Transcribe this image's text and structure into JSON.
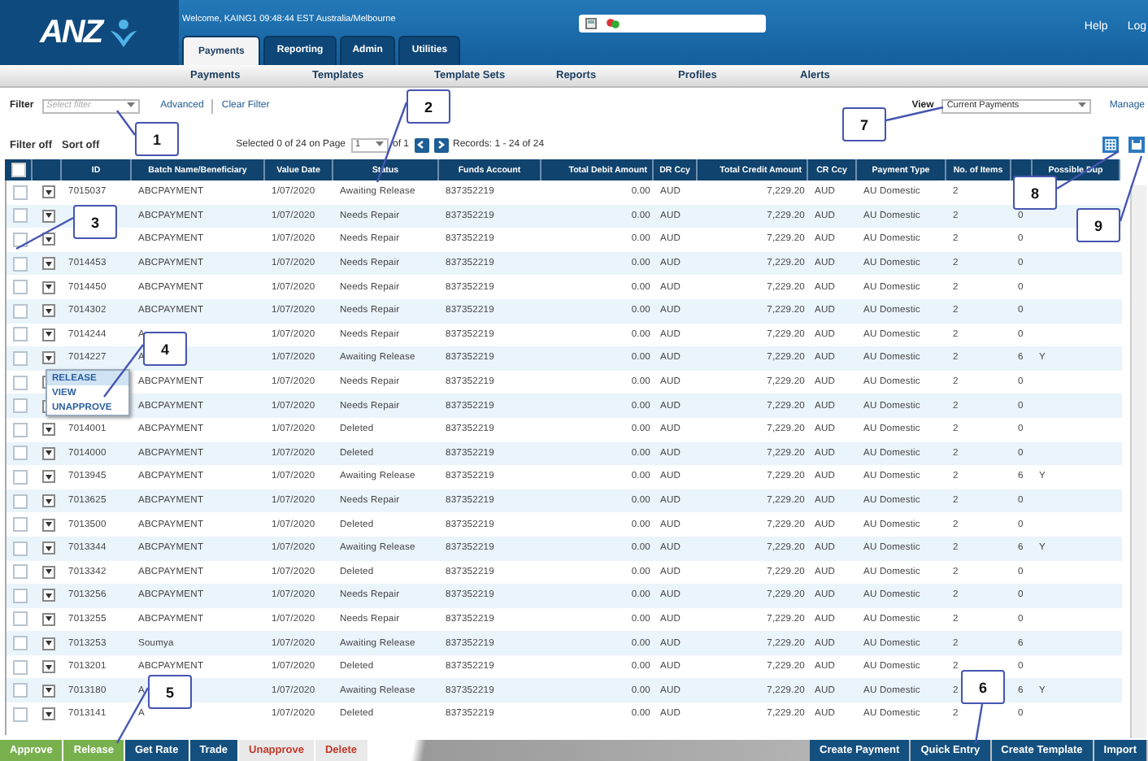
{
  "header": {
    "logo": "ANZ",
    "welcome": "Welcome, KAING1 09:48:44 EST Australia/Melbourne",
    "links": [
      "Help",
      "Log"
    ]
  },
  "tabs": [
    {
      "label": "Payments",
      "selected": true
    },
    {
      "label": "Reporting",
      "selected": false
    },
    {
      "label": "Admin",
      "selected": false
    },
    {
      "label": "Utilities",
      "selected": false
    }
  ],
  "subnav": [
    "Payments",
    "Templates",
    "Template Sets",
    "Reports",
    "Profiles",
    "Alerts"
  ],
  "filter": {
    "label": "Filter",
    "placeholder": "Select filter",
    "links": [
      "Advanced",
      "Clear Filter"
    ],
    "view_label": "View",
    "view_value": "Current Payments",
    "manage": "Manage"
  },
  "toolbar": {
    "filter_state": "Filter off",
    "sort_state": "Sort off",
    "selected_text": "Selected 0 of 24 on Page",
    "page": "1",
    "page_of": "of 1",
    "records": "Records: 1 - 24 of 24"
  },
  "table": {
    "all_checked": false,
    "columns": [
      "ID",
      "Batch Name/Beneficiary",
      "Value Date",
      "Status",
      "Funds Account",
      "Total Debit Amount",
      "DR Ccy",
      "Total Credit Amount",
      "CR Ccy",
      "Payment Type",
      "No. of Items",
      "",
      "Possible Dup"
    ],
    "rows": [
      {
        "checked": false,
        "cells": [
          "7015037",
          "ABCPAYMENT",
          "1/07/2020",
          "Awaiting Release",
          "837352219",
          "0.00",
          "AUD",
          "7,229.20",
          "AUD",
          "AU Domestic",
          "2",
          null,
          null
        ]
      },
      {
        "checked": false,
        "cells": [
          null,
          "ABCPAYMENT",
          "1/07/2020",
          "Needs Repair",
          "837352219",
          "0.00",
          "AUD",
          "7,229.20",
          "AUD",
          "AU Domestic",
          "2",
          "0",
          null
        ]
      },
      {
        "checked": false,
        "cells": [
          null,
          "ABCPAYMENT",
          "1/07/2020",
          "Needs Repair",
          "837352219",
          "0.00",
          "AUD",
          "7,229.20",
          "AUD",
          "AU Domestic",
          "2",
          "0",
          null
        ]
      },
      {
        "checked": false,
        "cells": [
          "7014453",
          "ABCPAYMENT",
          "1/07/2020",
          "Needs Repair",
          "837352219",
          "0.00",
          "AUD",
          "7,229.20",
          "AUD",
          "AU Domestic",
          "2",
          "0",
          null
        ]
      },
      {
        "checked": false,
        "cells": [
          "7014450",
          "ABCPAYMENT",
          "1/07/2020",
          "Needs Repair",
          "837352219",
          "0.00",
          "AUD",
          "7,229.20",
          "AUD",
          "AU Domestic",
          "2",
          "0",
          null
        ]
      },
      {
        "checked": false,
        "cells": [
          "7014302",
          "ABCPAYMENT",
          "1/07/2020",
          "Needs Repair",
          "837352219",
          "0.00",
          "AUD",
          "7,229.20",
          "AUD",
          "AU Domestic",
          "2",
          "0",
          null
        ]
      },
      {
        "checked": false,
        "cells": [
          "7014244",
          "A",
          "1/07/2020",
          "Needs Repair",
          "837352219",
          "0.00",
          "AUD",
          "7,229.20",
          "AUD",
          "AU Domestic",
          "2",
          "0",
          null
        ]
      },
      {
        "checked": false,
        "cells": [
          "7014227",
          "A",
          "1/07/2020",
          "Awaiting Release",
          "837352219",
          "0.00",
          "AUD",
          "7,229.20",
          "AUD",
          "AU Domestic",
          "2",
          "6",
          "Y"
        ]
      },
      {
        "checked": false,
        "cells": [
          null,
          "ABCPAYMENT",
          "1/07/2020",
          "Needs Repair",
          "837352219",
          "0.00",
          "AUD",
          "7,229.20",
          "AUD",
          "AU Domestic",
          "2",
          "0",
          null
        ]
      },
      {
        "checked": false,
        "cells": [
          null,
          "ABCPAYMENT",
          "1/07/2020",
          "Needs Repair",
          "837352219",
          "0.00",
          "AUD",
          "7,229.20",
          "AUD",
          "AU Domestic",
          "2",
          "0",
          null
        ]
      },
      {
        "checked": false,
        "cells": [
          "7014001",
          "ABCPAYMENT",
          "1/07/2020",
          "Deleted",
          "837352219",
          "0.00",
          "AUD",
          "7,229.20",
          "AUD",
          "AU Domestic",
          "2",
          "0",
          null
        ]
      },
      {
        "checked": false,
        "cells": [
          "7014000",
          "ABCPAYMENT",
          "1/07/2020",
          "Deleted",
          "837352219",
          "0.00",
          "AUD",
          "7,229.20",
          "AUD",
          "AU Domestic",
          "2",
          "0",
          null
        ]
      },
      {
        "checked": false,
        "cells": [
          "7013945",
          "ABCPAYMENT",
          "1/07/2020",
          "Awaiting Release",
          "837352219",
          "0.00",
          "AUD",
          "7,229.20",
          "AUD",
          "AU Domestic",
          "2",
          "6",
          "Y"
        ]
      },
      {
        "checked": false,
        "cells": [
          "7013625",
          "ABCPAYMENT",
          "1/07/2020",
          "Needs Repair",
          "837352219",
          "0.00",
          "AUD",
          "7,229.20",
          "AUD",
          "AU Domestic",
          "2",
          "0",
          null
        ]
      },
      {
        "checked": false,
        "cells": [
          "7013500",
          "ABCPAYMENT",
          "1/07/2020",
          "Deleted",
          "837352219",
          "0.00",
          "AUD",
          "7,229.20",
          "AUD",
          "AU Domestic",
          "2",
          "0",
          null
        ]
      },
      {
        "checked": false,
        "cells": [
          "7013344",
          "ABCPAYMENT",
          "1/07/2020",
          "Awaiting Release",
          "837352219",
          "0.00",
          "AUD",
          "7,229.20",
          "AUD",
          "AU Domestic",
          "2",
          "6",
          "Y"
        ]
      },
      {
        "checked": false,
        "cells": [
          "7013342",
          "ABCPAYMENT",
          "1/07/2020",
          "Deleted",
          "837352219",
          "0.00",
          "AUD",
          "7,229.20",
          "AUD",
          "AU Domestic",
          "2",
          "0",
          null
        ]
      },
      {
        "checked": false,
        "cells": [
          "7013256",
          "ABCPAYMENT",
          "1/07/2020",
          "Needs Repair",
          "837352219",
          "0.00",
          "AUD",
          "7,229.20",
          "AUD",
          "AU Domestic",
          "2",
          "0",
          null
        ]
      },
      {
        "checked": false,
        "cells": [
          "7013255",
          "ABCPAYMENT",
          "1/07/2020",
          "Needs Repair",
          "837352219",
          "0.00",
          "AUD",
          "7,229.20",
          "AUD",
          "AU Domestic",
          "2",
          "0",
          null
        ]
      },
      {
        "checked": false,
        "cells": [
          "7013253",
          "Soumya",
          "1/07/2020",
          "Awaiting Release",
          "837352219",
          "0.00",
          "AUD",
          "7,229.20",
          "AUD",
          "AU Domestic",
          "2",
          "6",
          null
        ]
      },
      {
        "checked": false,
        "cells": [
          "7013201",
          "ABCPAYMENT",
          "1/07/2020",
          "Deleted",
          "837352219",
          "0.00",
          "AUD",
          "7,229.20",
          "AUD",
          "AU Domestic",
          "2",
          "0",
          null
        ]
      },
      {
        "checked": false,
        "cells": [
          "7013180",
          "A",
          "1/07/2020",
          "Awaiting Release",
          "837352219",
          "0.00",
          "AUD",
          "7,229.20",
          "AUD",
          "AU Domestic",
          "2",
          "6",
          "Y"
        ]
      },
      {
        "checked": false,
        "cells": [
          "7013141",
          "A",
          "1/07/2020",
          "Deleted",
          "837352219",
          "0.00",
          "AUD",
          "7,229.20",
          "AUD",
          "AU Domestic",
          "2",
          "0",
          null
        ]
      }
    ]
  },
  "row_menu": {
    "items": [
      {
        "label": "RELEASE",
        "selected": true
      },
      {
        "label": "VIEW",
        "selected": false
      },
      {
        "label": "UNAPPROVE",
        "selected": false
      }
    ]
  },
  "actions_left": [
    {
      "label": "Approve",
      "kind": "green"
    },
    {
      "label": "Release",
      "kind": "green"
    },
    {
      "label": "Get Rate",
      "kind": "blue"
    },
    {
      "label": "Trade",
      "kind": "blue"
    },
    {
      "label": "Unapprove",
      "kind": "danger"
    },
    {
      "label": "Delete",
      "kind": "danger"
    }
  ],
  "actions_right": [
    {
      "label": "Create Payment",
      "kind": "blue"
    },
    {
      "label": "Quick Entry",
      "kind": "blue"
    },
    {
      "label": "Create Template",
      "kind": "blue"
    },
    {
      "label": "Import",
      "kind": "blue"
    }
  ],
  "callouts": [
    "1",
    "2",
    "3",
    "4",
    "5",
    "6",
    "7",
    "8",
    "9"
  ]
}
